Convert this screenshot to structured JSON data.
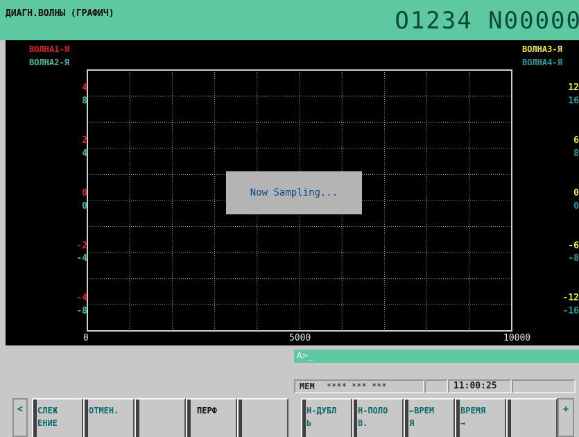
{
  "title": {
    "left": "ДИАГН.ВОЛНЫ (ГРАФИЧ)",
    "right": "O1234 N00000"
  },
  "legend": {
    "wave1": "ВОЛНА1-Я",
    "wave2": "ВОЛНА2-Я",
    "wave3": "ВОЛНА3-Я",
    "wave4": "ВОЛНА4-Я"
  },
  "chart_data": {
    "type": "line",
    "series": [
      {
        "name": "ВОЛНА1-Я",
        "values": []
      },
      {
        "name": "ВОЛНА2-Я",
        "values": []
      },
      {
        "name": "ВОЛНА3-Я",
        "values": []
      },
      {
        "name": "ВОЛНА4-Я",
        "values": []
      }
    ],
    "x_ticks": [
      "0",
      "5000",
      "10000"
    ],
    "xlim": [
      0,
      10000
    ],
    "y_ticks_wave1": [
      "4",
      "2",
      "0",
      "-2",
      "-4"
    ],
    "y_ticks_wave2": [
      "8",
      "4",
      "0",
      "-4",
      "-8"
    ],
    "y_ticks_wave3": [
      "12",
      "6",
      "0",
      "-6",
      "-12"
    ],
    "y_ticks_wave4": [
      "16",
      "8",
      "0",
      "-8",
      "-16"
    ],
    "ylim_wave1": [
      -4,
      4
    ],
    "ylim_wave2": [
      -8,
      8
    ],
    "ylim_wave3": [
      -12,
      12
    ],
    "ylim_wave4": [
      -16,
      16
    ],
    "grid": true
  },
  "popup": "Now Sampling...",
  "input_prompt": "A>_",
  "status": {
    "mode": "MEM",
    "info": "**** *** ***",
    "time": "11:00:25"
  },
  "softkeys": {
    "left_arrow": "<",
    "right_arrow": "+",
    "keys": [
      {
        "line1": "СЛЕЖ",
        "line2": "ЕНИЕ"
      },
      {
        "line1": "ОТМЕН.",
        "line2": ""
      },
      {
        "line1": "",
        "line2": ""
      },
      {
        "line1": "ПЕРФ",
        "line2": ""
      },
      {
        "line1": "",
        "line2": ""
      },
      {
        "line1": "Н-ДУБЛ",
        "line2": "Ь"
      },
      {
        "line1": "Н-ПОЛО",
        "line2": "В."
      },
      {
        "line1": "←ВРЕМ",
        "line2": "Я"
      },
      {
        "line1": "ВРЕМЯ",
        "line2": "→"
      },
      {
        "line1": "",
        "line2": ""
      }
    ]
  },
  "colors": {
    "wave1": "#e02020",
    "wave2": "#40c0a0",
    "wave3": "#f0f020",
    "wave4": "#20a0a0",
    "title_bar": "#5ec8a0"
  }
}
